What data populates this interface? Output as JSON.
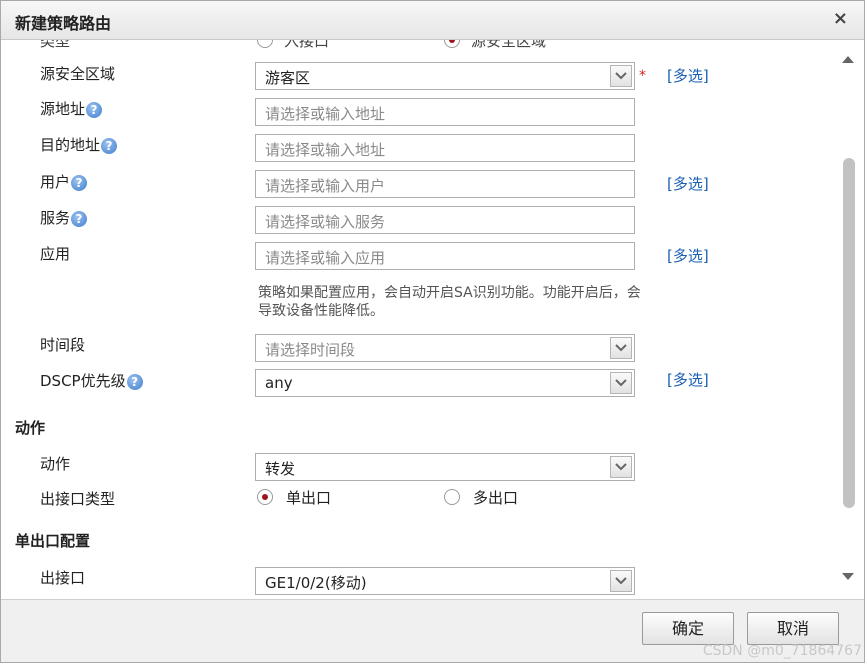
{
  "dialog": {
    "title": "新建策略路由",
    "close_glyph": "×",
    "confirm_label": "确定",
    "cancel_label": "取消",
    "watermark": "CSDN @m0_71864767"
  },
  "form": {
    "type_row": {
      "label": "类型",
      "option1": "入接口",
      "option2": "源安全区域",
      "selected": "源安全区域"
    },
    "src_zone": {
      "label": "源安全区域",
      "value": "游客区",
      "required_mark": "*",
      "multi": "[多选]"
    },
    "src_addr": {
      "label": "源地址",
      "placeholder": "请选择或输入地址"
    },
    "dst_addr": {
      "label": "目的地址",
      "placeholder": "请选择或输入地址"
    },
    "user": {
      "label": "用户",
      "placeholder": "请选择或输入用户",
      "multi": "[多选]"
    },
    "service": {
      "label": "服务",
      "placeholder": "请选择或输入服务"
    },
    "application": {
      "label": "应用",
      "placeholder": "请选择或输入应用",
      "multi": "[多选]",
      "note": "策略如果配置应用，会自动开启SA识别功能。功能开启后，会导致设备性能降低。"
    },
    "time_range": {
      "label": "时间段",
      "placeholder": "请选择时间段"
    },
    "dscp": {
      "label": "DSCP优先级",
      "value": "any",
      "multi": "[多选]"
    },
    "help_glyph": "?"
  },
  "action_section": {
    "title": "动作",
    "action": {
      "label": "动作",
      "value": "转发"
    },
    "out_if_type": {
      "label": "出接口类型",
      "option1": "单出口",
      "option2": "多出口",
      "selected": "单出口"
    }
  },
  "single_out_section": {
    "title": "单出口配置",
    "out_if": {
      "label": "出接口",
      "value": "GE1/0/2(移动)"
    }
  },
  "colors": {
    "link": "#1a5fb4",
    "radio_selected": "#a0141e",
    "required": "#dd2222"
  },
  "icons": {
    "dropdown": "chevron-down-icon",
    "help": "question-circle-icon",
    "close": "close-icon"
  }
}
